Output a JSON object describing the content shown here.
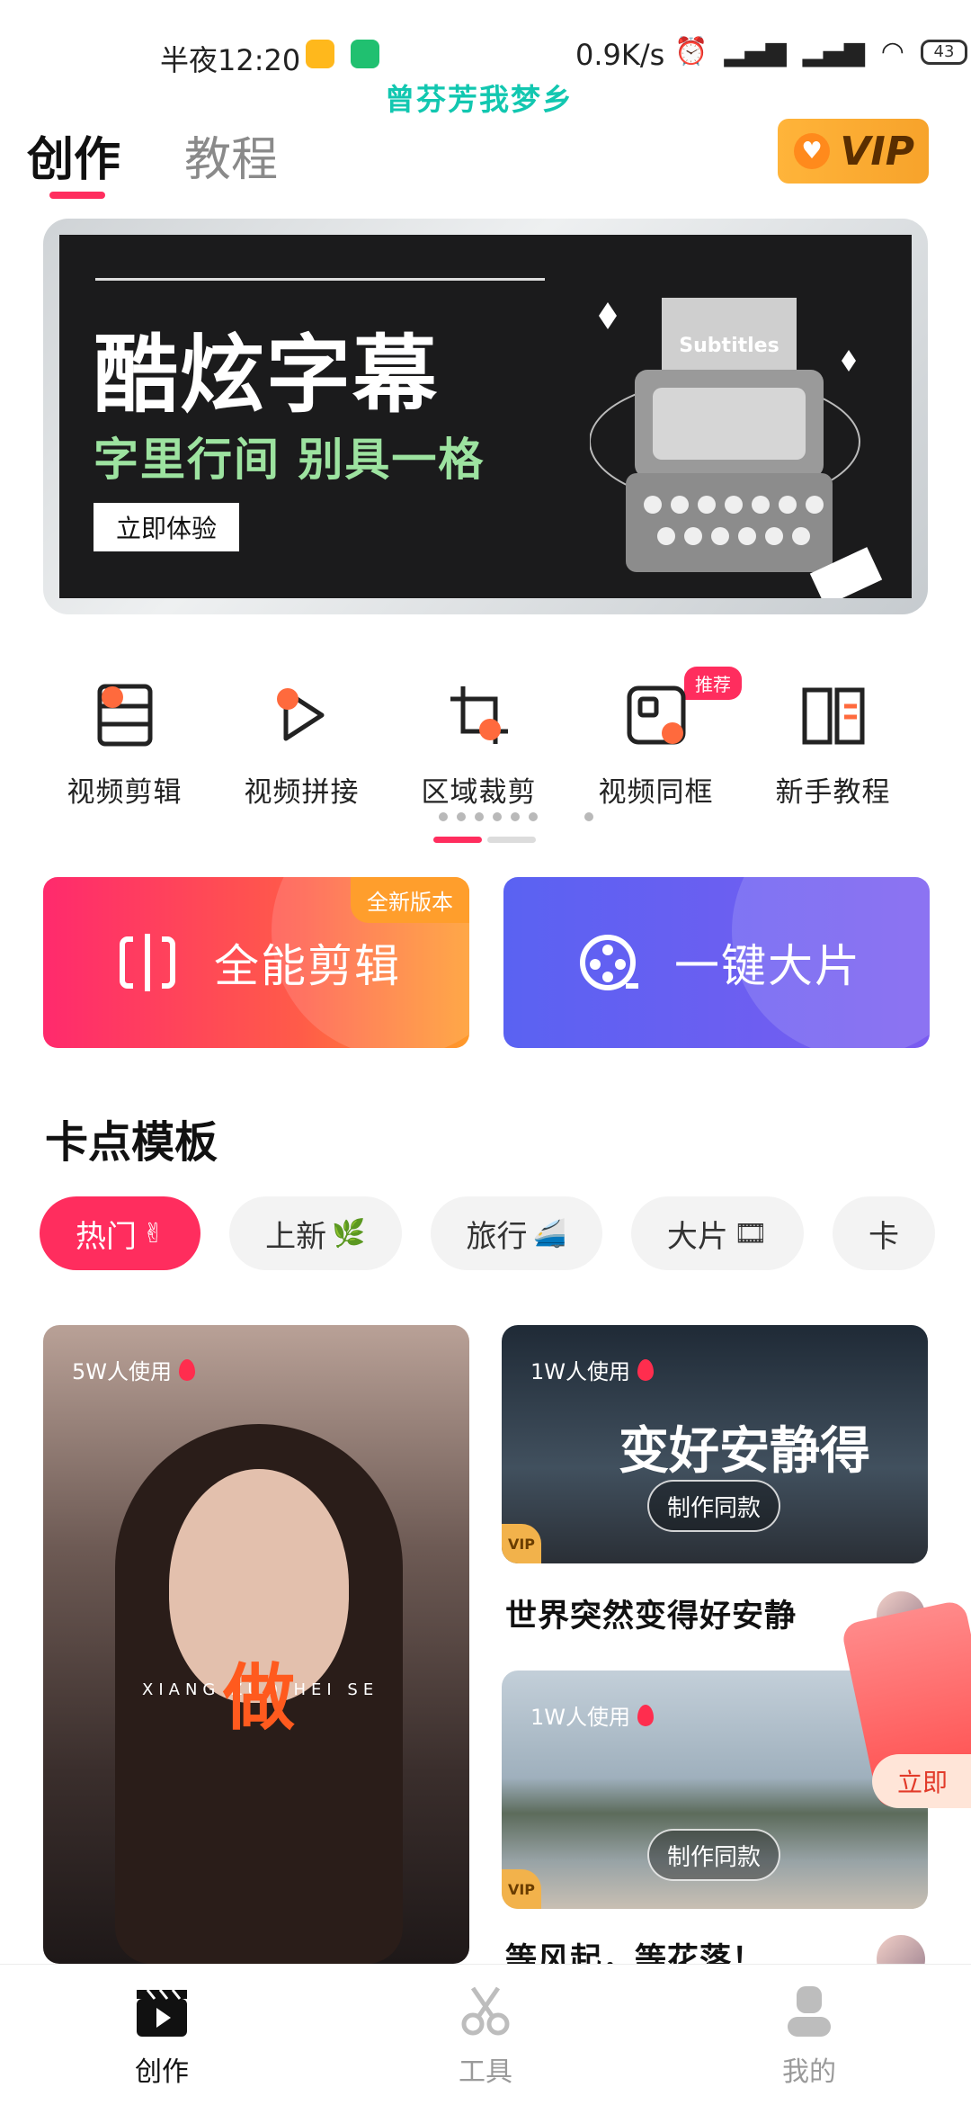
{
  "status_bar": {
    "time": "半夜12:20",
    "network_speed": "0.9K/s",
    "battery": "43"
  },
  "watermark": "曾芬芳我梦乡",
  "header": {
    "tabs": [
      {
        "label": "创作"
      },
      {
        "label": "教程"
      }
    ],
    "vip_label": "VIP"
  },
  "banner": {
    "title": "酷炫字幕",
    "subtitle": "字里行间 别具一格",
    "button": "立即体验",
    "image_text": "Subtitles",
    "slide_count": 8,
    "active_slide": 7
  },
  "tools": [
    {
      "label": "视频剪辑",
      "icon": "film-strip-icon"
    },
    {
      "label": "视频拼接",
      "icon": "video-join-icon"
    },
    {
      "label": "区域裁剪",
      "icon": "crop-icon"
    },
    {
      "label": "视频同框",
      "icon": "split-frame-icon",
      "badge": "推荐"
    },
    {
      "label": "新手教程",
      "icon": "book-icon"
    }
  ],
  "action_cards": {
    "edit": {
      "label": "全能剪辑",
      "badge": "全新版本"
    },
    "auto": {
      "label": "一键大片"
    }
  },
  "templates_section": {
    "title": "卡点模板",
    "chips": [
      {
        "label": "热门",
        "emoji": "✌"
      },
      {
        "label": "上新",
        "emoji": "🌿"
      },
      {
        "label": "旅行",
        "emoji": "🚄"
      },
      {
        "label": "大片",
        "emoji": "🎞"
      },
      {
        "label": "卡"
      }
    ],
    "cards": [
      {
        "uses": "5W人使用",
        "overlay_word": "做",
        "caption": "XIANG ZUO HEI SE"
      },
      {
        "uses": "1W人使用",
        "overlay_word": "变好安静得",
        "button": "制作同款",
        "title": "世界突然变得好安静"
      },
      {
        "uses": "1W人使用",
        "button": "制作同款",
        "title": "等风起，等花落！..."
      }
    ]
  },
  "floating_packet": {
    "button": "立即"
  },
  "bottom_nav": [
    {
      "label": "创作",
      "icon": "clapperboard-icon"
    },
    {
      "label": "工具",
      "icon": "scissors-icon"
    },
    {
      "label": "我的",
      "icon": "profile-icon"
    }
  ],
  "colors": {
    "accent": "#ff2d5e",
    "vip": "#f7a32b",
    "auto_card": "#5a62f2"
  }
}
